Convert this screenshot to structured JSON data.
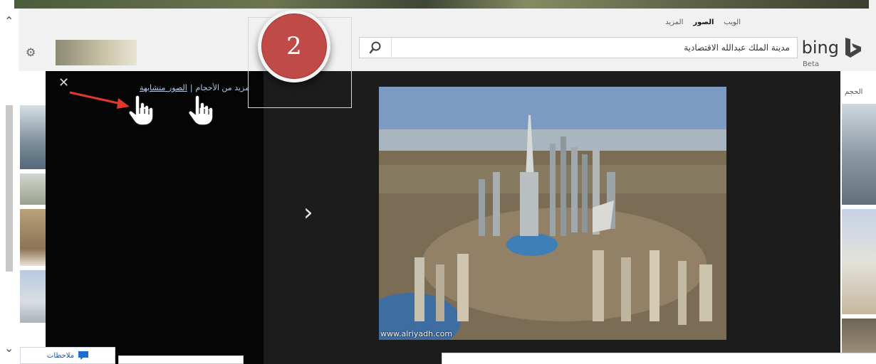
{
  "header": {
    "nav": [
      {
        "label": "الويب",
        "active": false
      },
      {
        "label": "الصور",
        "active": true
      },
      {
        "label": "المزيد",
        "active": false
      }
    ],
    "brand": "bing",
    "brand_tag": "Beta",
    "search": {
      "value": "مدينة الملك عبدالله الاقتصادية",
      "icon": "search-icon"
    },
    "settings_icon": "gear-icon"
  },
  "step_badge": {
    "number": "2",
    "color": "#c04a48"
  },
  "detail_panel": {
    "close_label": "✕",
    "more_sizes_label": "مزيد من الأحجام",
    "separator": "|",
    "similar_images_label": "الصور متشابهة",
    "next_label": "›",
    "watermark": "www.alriyadh.com"
  },
  "right_strip": {
    "size_label": "الحجم"
  },
  "footer": {
    "feedback_label": "ملاحظات",
    "feedback_icon": "speech-bubble-icon"
  }
}
